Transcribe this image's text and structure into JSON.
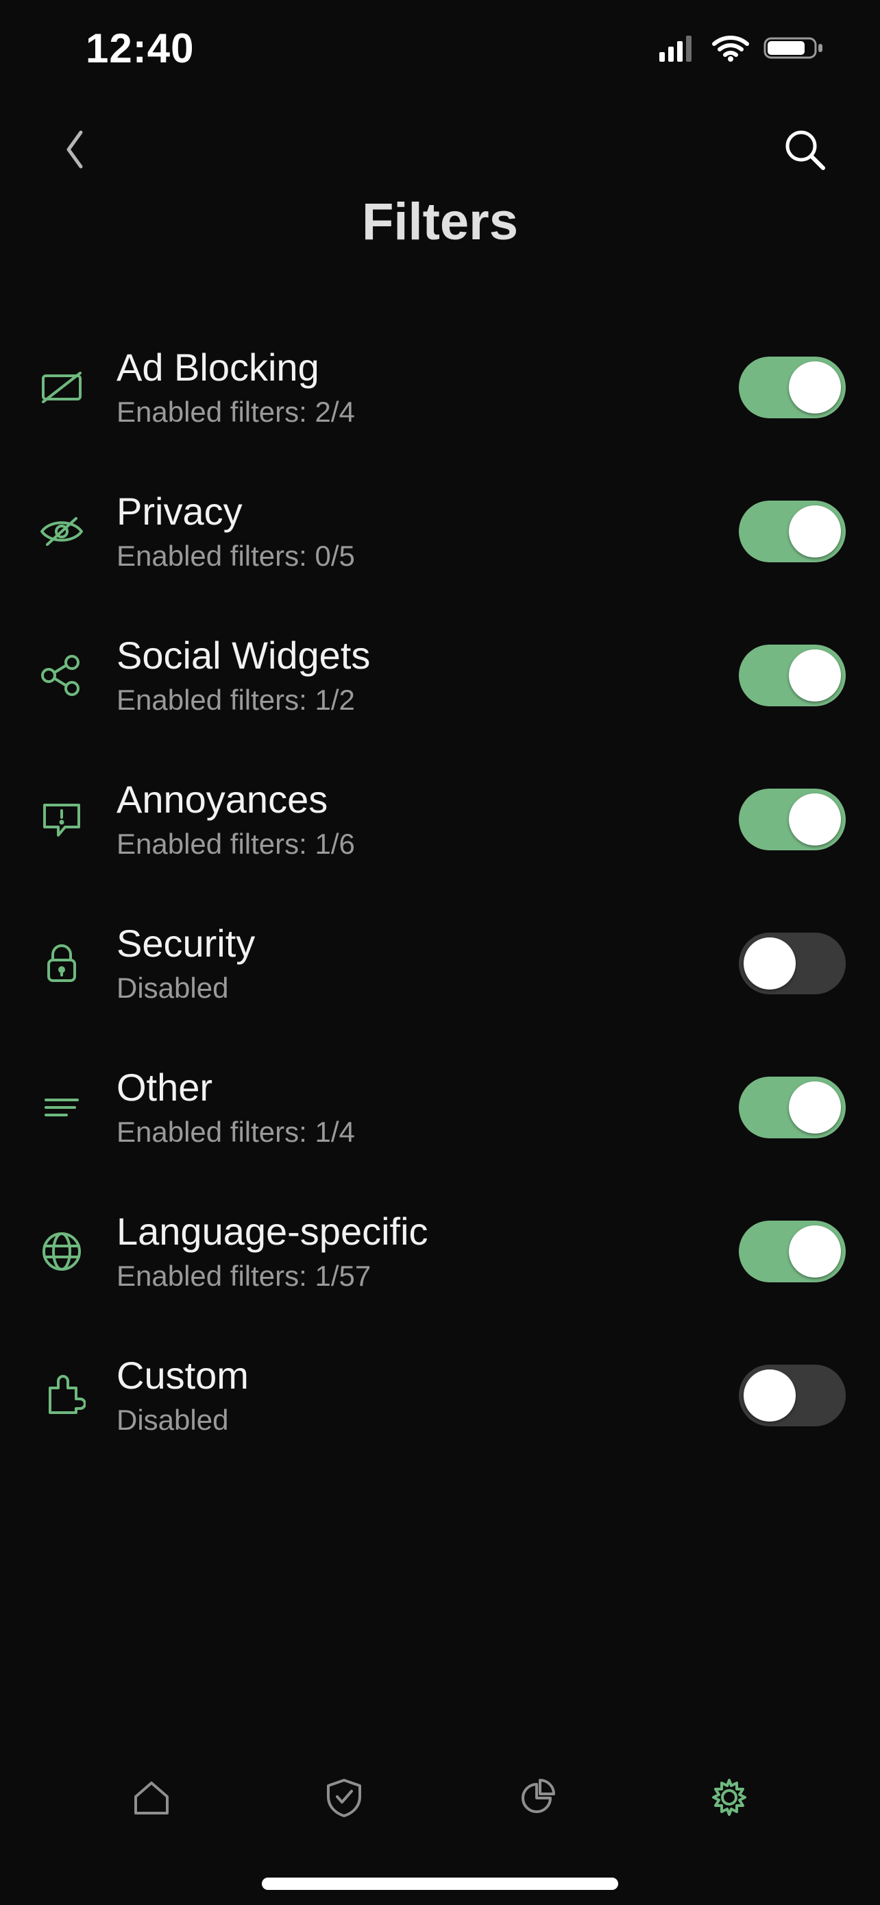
{
  "status": {
    "time": "12:40"
  },
  "header": {
    "title": "Filters"
  },
  "filters": [
    {
      "icon": "ad-blocking",
      "title": "Ad Blocking",
      "subtitle": "Enabled filters: 2/4",
      "enabled": true
    },
    {
      "icon": "privacy",
      "title": "Privacy",
      "subtitle": "Enabled filters: 0/5",
      "enabled": true
    },
    {
      "icon": "social",
      "title": "Social Widgets",
      "subtitle": "Enabled filters: 1/2",
      "enabled": true
    },
    {
      "icon": "annoyances",
      "title": "Annoyances",
      "subtitle": "Enabled filters: 1/6",
      "enabled": true
    },
    {
      "icon": "security",
      "title": "Security",
      "subtitle": "Disabled",
      "enabled": false
    },
    {
      "icon": "other",
      "title": "Other",
      "subtitle": "Enabled filters: 1/4",
      "enabled": true
    },
    {
      "icon": "language",
      "title": "Language-specific",
      "subtitle": "Enabled filters: 1/57",
      "enabled": true
    },
    {
      "icon": "custom",
      "title": "Custom",
      "subtitle": "Disabled",
      "enabled": false
    }
  ],
  "tabs": {
    "active": "settings"
  }
}
